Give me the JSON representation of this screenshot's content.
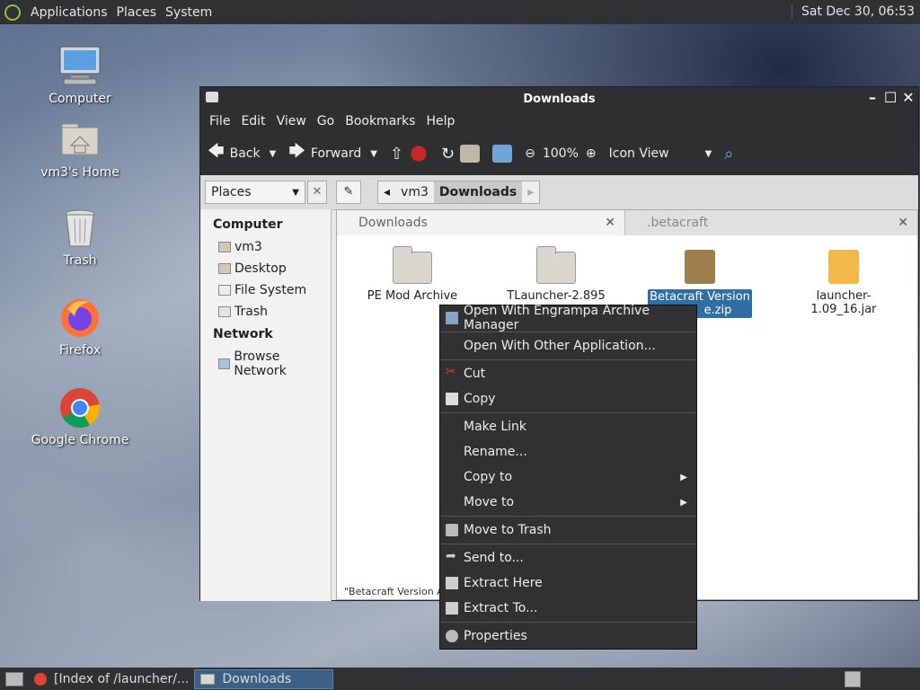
{
  "top_panel": {
    "menus": [
      "Applications",
      "Places",
      "System"
    ],
    "clock": "Sat Dec 30, 06:53"
  },
  "desktop_icons": [
    "Computer",
    "vm3's Home",
    "Trash",
    "Firefox",
    "Google Chrome"
  ],
  "window": {
    "title": "Downloads",
    "menubar": [
      "File",
      "Edit",
      "View",
      "Go",
      "Bookmarks",
      "Help"
    ],
    "toolbar": {
      "back": "Back",
      "forward": "Forward",
      "zoom": "100%",
      "view_mode": "Icon View"
    },
    "places_select": "Places",
    "breadcrumbs": [
      "vm3",
      "Downloads"
    ],
    "sidebar": {
      "computer_heading": "Computer",
      "computer_items": [
        "vm3",
        "Desktop",
        "File System",
        "Trash"
      ],
      "network_heading": "Network",
      "network_items": [
        "Browse Network"
      ]
    },
    "tabs": [
      "Downloads",
      ".betacraft"
    ],
    "files": [
      "PE Mod Archive",
      "TLauncher-2.895",
      "Betacraft Version",
      "launcher-1.09_16.jar"
    ],
    "selected_file_suffix": "e.zip",
    "status": "\"Betacraft Version A"
  },
  "context_menu": {
    "items": [
      "Open With Engrampa Archive Manager",
      "Open With Other Application...",
      "Cut",
      "Copy",
      "Make Link",
      "Rename...",
      "Copy to",
      "Move to",
      "Move to Trash",
      "Send to...",
      "Extract Here",
      "Extract To...",
      "Properties"
    ]
  },
  "taskbar": {
    "tasks": [
      "[Index of /launcher/...",
      "Downloads"
    ]
  },
  "colors": {
    "panel": "#2f3133",
    "selection": "#2f6ea5",
    "active_task": "#3c5f86"
  }
}
